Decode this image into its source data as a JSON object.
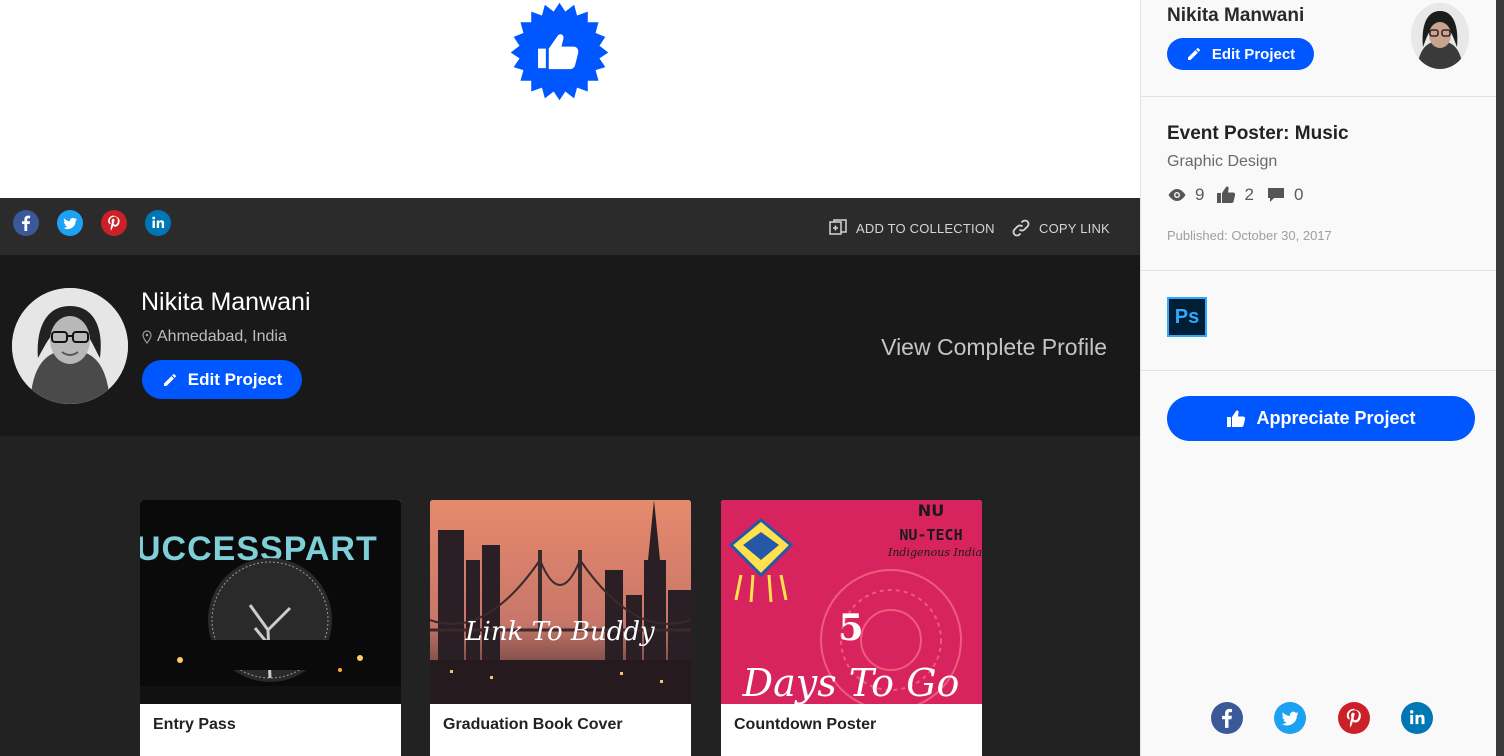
{
  "share_bar": {
    "add_to_collection": "ADD TO COLLECTION",
    "copy_link": "COPY LINK"
  },
  "owner": {
    "name": "Nikita Manwani",
    "location": "Ahmedabad, India",
    "edit_label": "Edit Project",
    "view_profile": "View Complete Profile"
  },
  "more_projects": [
    {
      "title": "Entry Pass"
    },
    {
      "title": "Graduation Book Cover"
    },
    {
      "title": "Countdown Poster"
    }
  ],
  "sidebar": {
    "owner_name": "Nikita Manwani",
    "edit_label": "Edit Project",
    "project_title": "Event Poster: Music",
    "field": "Graphic Design",
    "views": "9",
    "appreciations": "2",
    "comments": "0",
    "published": "Published: October 30, 2017",
    "tool_badge": "Ps",
    "appreciate_label": "Appreciate Project"
  },
  "colors": {
    "accent": "#0057ff",
    "facebook": "#3b5998",
    "twitter": "#1da1f2",
    "pinterest": "#cb2027",
    "linkedin": "#0077b5"
  },
  "icons": [
    "thumbs-up-icon",
    "facebook-icon",
    "twitter-icon",
    "pinterest-icon",
    "linkedin-icon",
    "collection-icon",
    "link-icon",
    "location-pin-icon",
    "pencil-icon",
    "eye-icon",
    "comment-icon"
  ]
}
